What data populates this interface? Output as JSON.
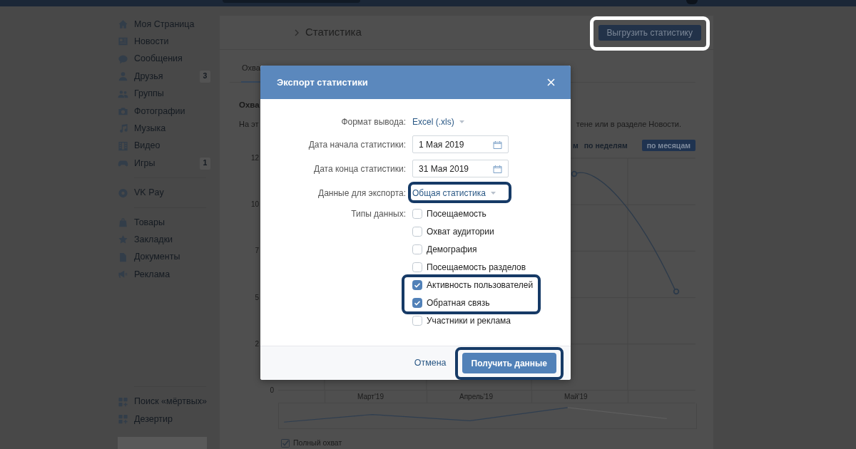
{
  "sidebar": {
    "sections": [
      {
        "items": [
          {
            "label": "Моя Страница"
          },
          {
            "label": "Новости"
          },
          {
            "label": "Сообщения"
          },
          {
            "label": "Друзья",
            "badge": "3"
          },
          {
            "label": "Группы"
          },
          {
            "label": "Фотографии"
          },
          {
            "label": "Музыка"
          },
          {
            "label": "Видео"
          },
          {
            "label": "Игры",
            "badge": "1"
          }
        ]
      },
      {
        "items": [
          {
            "label": "VK Pay"
          }
        ]
      },
      {
        "items": [
          {
            "label": "Товары"
          },
          {
            "label": "Закладки"
          },
          {
            "label": "Документы"
          },
          {
            "label": "Реклама"
          }
        ]
      },
      {
        "items": [
          {
            "label": "Поиск «мёртвых»"
          },
          {
            "label": "Дезертир"
          }
        ]
      }
    ]
  },
  "page": {
    "title": "Статистика",
    "export_button": {
      "label": "Выгрузить статистику",
      "highlighted": true
    },
    "tabs": [
      {
        "label": "Охва",
        "selected": true
      }
    ],
    "section_title": "Охва",
    "description_fragments": [
      "На эт",
      "тене или в разделе Новости."
    ],
    "period_buttons": [
      {
        "label": "м",
        "selected": false
      },
      {
        "label": "по неделям",
        "selected": false
      },
      {
        "label": "по месяцам",
        "selected": true
      }
    ],
    "chart": {
      "y_labels": [
        "12",
        "10",
        "7",
        "5",
        "2",
        "0"
      ],
      "x_labels": [
        "Март'19",
        "Апрель'19",
        "Май'19"
      ]
    },
    "legend": [
      {
        "label": "Полный охват",
        "checked": true
      }
    ]
  },
  "modal": {
    "title": "Экспорт статистики",
    "fields": [
      {
        "kind": "dropdown",
        "label": "Формат вывода:",
        "value": "Excel (.xls)",
        "highlighted": false
      },
      {
        "kind": "date",
        "label": "Дата начала статистики:",
        "value": "1 Мая 2019"
      },
      {
        "kind": "date",
        "label": "Дата конца статистики:",
        "value": "31 Мая 2019"
      },
      {
        "kind": "dropdown",
        "label": "Данные для экспорта:",
        "value": "Общая статистика",
        "highlighted": true
      },
      {
        "kind": "checkboxes",
        "label": "Типы данных:",
        "options": [
          {
            "label": "Посещаемость",
            "checked": false,
            "highlighted": false
          },
          {
            "label": "Охват аудитории",
            "checked": false,
            "highlighted": false
          },
          {
            "label": "Демография",
            "checked": false,
            "highlighted": false
          },
          {
            "label": "Посещаемость разделов",
            "checked": false,
            "highlighted": false
          },
          {
            "label": "Активность пользователей",
            "checked": true,
            "highlighted": true
          },
          {
            "label": "Обратная связь",
            "checked": true,
            "highlighted": true
          },
          {
            "label": "Участники и реклама",
            "checked": false,
            "highlighted": false
          }
        ]
      }
    ],
    "cancel": "Отмена",
    "submit": {
      "label": "Получить данные",
      "highlighted": true
    }
  }
}
